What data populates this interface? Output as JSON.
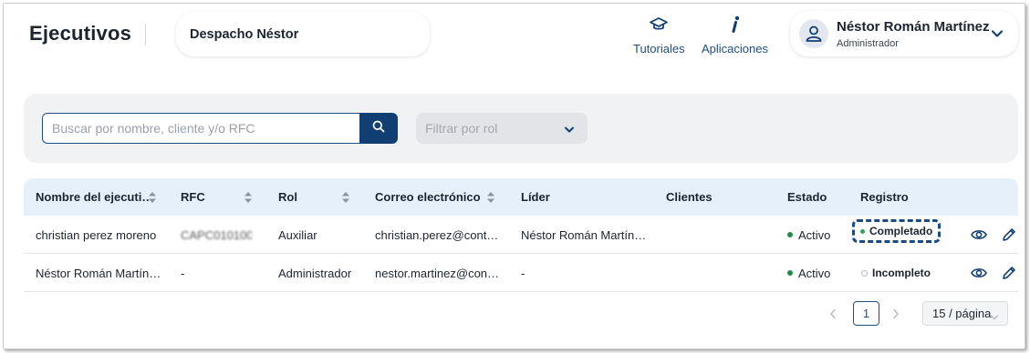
{
  "header": {
    "title": "Ejecutivos",
    "firm": "Despacho Néstor",
    "nav": [
      {
        "label": "Tutoriales",
        "icon": "graduation-cap-icon"
      },
      {
        "label": "Aplicaciones",
        "icon": "info-icon"
      }
    ],
    "user": {
      "name": "Néstor Román Martínez",
      "role": "Administrador",
      "avatar_icon": "user-icon"
    }
  },
  "filters": {
    "search_placeholder": "Buscar por nombre, cliente y/o RFC",
    "search_icon": "search-icon",
    "role_placeholder": "Filtrar por rol"
  },
  "table": {
    "columns": [
      "Nombre del ejecuti…",
      "RFC",
      "Rol",
      "Correo electrónico",
      "Líder",
      "Clientes",
      "Estado",
      "Registro"
    ],
    "rows": [
      {
        "name": "christian perez moreno",
        "rfc": "CAPC010100…",
        "role": "Auxiliar",
        "email": "christian.perez@cont…",
        "leader": "Néstor Román Martín…",
        "clients": "",
        "status": "Activo",
        "registro": "Completado"
      },
      {
        "name": "Néstor Román Martín…",
        "rfc": "-",
        "role": "Administrador",
        "email": "nestor.martinez@con…",
        "leader": "-",
        "clients": "",
        "status": "Activo",
        "registro": "Incompleto"
      }
    ]
  },
  "pagination": {
    "current_page": "1",
    "page_size": "15 / página"
  },
  "colors": {
    "primary": "#123f73",
    "header_bg": "#e6f0fb",
    "active_green": "#1f8c4a",
    "completed_dot": "#2ea35b",
    "incomplete_dot": "#b8bcc3"
  }
}
